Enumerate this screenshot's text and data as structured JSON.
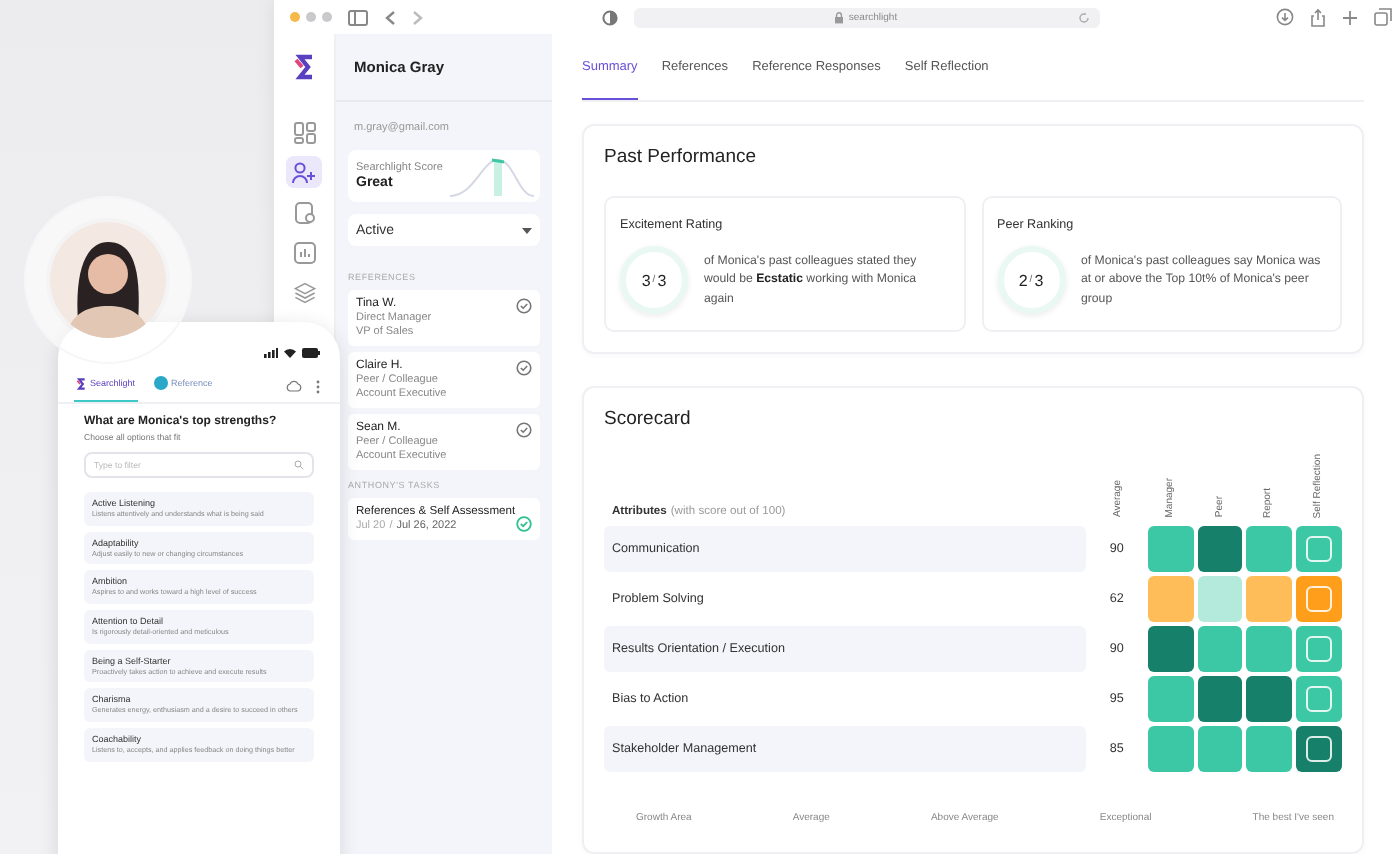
{
  "browser": {
    "url": "searchlight"
  },
  "candidate": {
    "name": "Monica Gray",
    "email": "m.gray@gmail.com",
    "score_label": "Searchlight Score",
    "score_value": "Great",
    "status": "Active"
  },
  "rail": [
    {
      "selected": false
    },
    {
      "selected": true
    },
    {
      "selected": false
    },
    {
      "selected": false
    },
    {
      "selected": false
    }
  ],
  "references_heading": "REFERENCES",
  "references": [
    {
      "name": "Tina W.",
      "relation": "Direct Manager",
      "title": "VP of Sales",
      "checked": true
    },
    {
      "name": "Claire H.",
      "relation": "Peer / Colleague",
      "title": "Account Executive",
      "checked": true
    },
    {
      "name": "Sean M.",
      "relation": "Peer / Colleague",
      "title": "Account Executive",
      "checked": true
    }
  ],
  "tasks_heading": "ANTHONY'S TASKS",
  "tasks": [
    {
      "title": "References & Self Assessment",
      "start": "Jul 20",
      "separator": "/",
      "end": "Jul 26, 2022",
      "done": true
    }
  ],
  "tabs": [
    {
      "label": "Summary",
      "selected": true
    },
    {
      "label": "References",
      "selected": false
    },
    {
      "label": "Reference Responses",
      "selected": false
    },
    {
      "label": "Self Reflection",
      "selected": false
    }
  ],
  "past_performance": {
    "title": "Past Performance",
    "cards": [
      {
        "title": "Excitement Rating",
        "value": "3",
        "separator": "/",
        "total": "3",
        "text": "of Monica's past colleagues stated they would be **Ecstatic** working with Monica again"
      },
      {
        "title": "Peer Ranking",
        "value": "2",
        "separator": "/",
        "total": "3",
        "text": "of Monica's past colleagues say Monica was at or above the Top 10t% of Monica's peer group"
      }
    ]
  },
  "scorecard": {
    "title": "Scorecard",
    "attributes_label": "Attributes",
    "attributes_note": "(with score out of 100)",
    "columns": [
      {
        "label": "Average",
        "kind": "number"
      },
      {
        "label": "Manager",
        "kind": "cell"
      },
      {
        "label": "Peer",
        "kind": "cell"
      },
      {
        "label": "Report",
        "kind": "cell"
      },
      {
        "label": "Self Reflection",
        "kind": "self"
      }
    ],
    "rows": [
      {
        "name": "Communication",
        "average": "90",
        "cells": [
          {
            "color": "#3dc8a5"
          },
          {
            "color": "#17806a"
          },
          {
            "color": "#3dc8a5"
          },
          {
            "color": "#3dc8a5"
          }
        ]
      },
      {
        "name": "Problem Solving",
        "average": "62",
        "cells": [
          {
            "color": "#ffbd59"
          },
          {
            "color": "#b3eadb"
          },
          {
            "color": "#ffbd59"
          },
          {
            "color": "#ff9e1b"
          }
        ]
      },
      {
        "name": "Results Orientation / Execution",
        "average": "90",
        "cells": [
          {
            "color": "#17806a"
          },
          {
            "color": "#3dc8a5"
          },
          {
            "color": "#3dc8a5"
          },
          {
            "color": "#3dc8a5"
          }
        ]
      },
      {
        "name": "Bias to Action",
        "average": "95",
        "cells": [
          {
            "color": "#3dc8a5"
          },
          {
            "color": "#17806a"
          },
          {
            "color": "#17806a"
          },
          {
            "color": "#3dc8a5"
          }
        ]
      },
      {
        "name": "Stakeholder Management",
        "average": "85",
        "cells": [
          {
            "color": "#3dc8a5"
          },
          {
            "color": "#3dc8a5"
          },
          {
            "color": "#3dc8a5"
          },
          {
            "color": "#17806a"
          }
        ]
      }
    ],
    "legend": [
      "Growth Area",
      "Average",
      "Above Average",
      "Exceptional",
      "The best I've seen"
    ]
  },
  "phone": {
    "tabs": [
      {
        "label": "Searchlight",
        "selected": true
      },
      {
        "label": "Reference",
        "selected": false
      }
    ],
    "question": "What are Monica's top strengths?",
    "hint": "Choose all options that fit",
    "filter_placeholder": "Type to filter",
    "options": [
      {
        "title": "Active Listening",
        "description": "Listens attentively and understands what is being said"
      },
      {
        "title": "Adaptability",
        "description": "Adjust easily to new or changing circumstances"
      },
      {
        "title": "Ambition",
        "description": "Aspires to and works toward a high level of success"
      },
      {
        "title": "Attention to Detail",
        "description": "Is rigorously detail-oriented and meticulous"
      },
      {
        "title": "Being a Self-Starter",
        "description": "Proactively takes action to achieve and execute results"
      },
      {
        "title": "Charisma",
        "description": "Generates energy, enthusiasm and a desire to succeed in others"
      },
      {
        "title": "Coachability",
        "description": "Listens to, accepts, and applies feedback on doing things better"
      }
    ]
  }
}
